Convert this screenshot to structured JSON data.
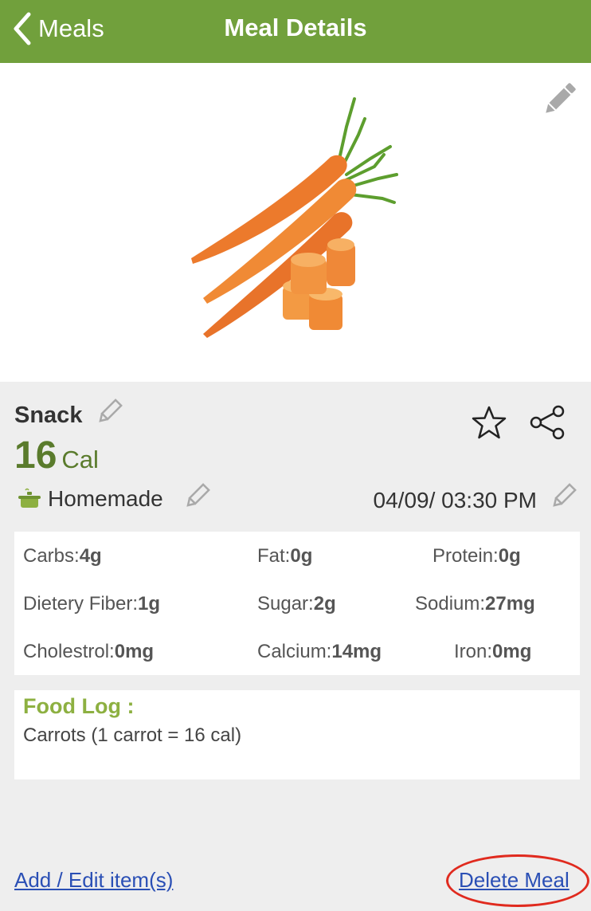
{
  "header": {
    "back_label": "Meals",
    "title": "Meal Details"
  },
  "meal": {
    "type": "Snack",
    "calories": "16",
    "calories_unit": "Cal",
    "source": "Homemade",
    "datetime": "04/09/ 03:30 PM"
  },
  "nutrients": [
    {
      "label": "Carbs:",
      "value": "4g"
    },
    {
      "label": "Fat:",
      "value": "0g"
    },
    {
      "label": "Protein:",
      "value": "0g"
    },
    {
      "label": "Dietery Fiber:",
      "value": "1g"
    },
    {
      "label": "Sugar:",
      "value": "2g"
    },
    {
      "label": "Sodium:",
      "value": "27mg"
    },
    {
      "label": "Cholestrol:",
      "value": "0mg"
    },
    {
      "label": "Calcium:",
      "value": "14mg"
    },
    {
      "label": "Iron:",
      "value": "0mg"
    }
  ],
  "food_log": {
    "title": "Food Log :",
    "items": [
      "Carrots (1 carrot = 16 cal)"
    ]
  },
  "actions": {
    "add_edit": "Add / Edit item(s)",
    "delete": "Delete Meal"
  },
  "icons": {
    "back": "chevron-left-icon",
    "photo_edit": "pencil-icon",
    "favorite": "star-icon",
    "share": "share-icon",
    "source": "cooking-pot-icon"
  },
  "colors": {
    "header_bg": "#71a03c",
    "calorie_text": "#5a7b2c",
    "food_log_title": "#8db041",
    "link": "#2a4fb5",
    "highlight": "#e02a1e"
  }
}
